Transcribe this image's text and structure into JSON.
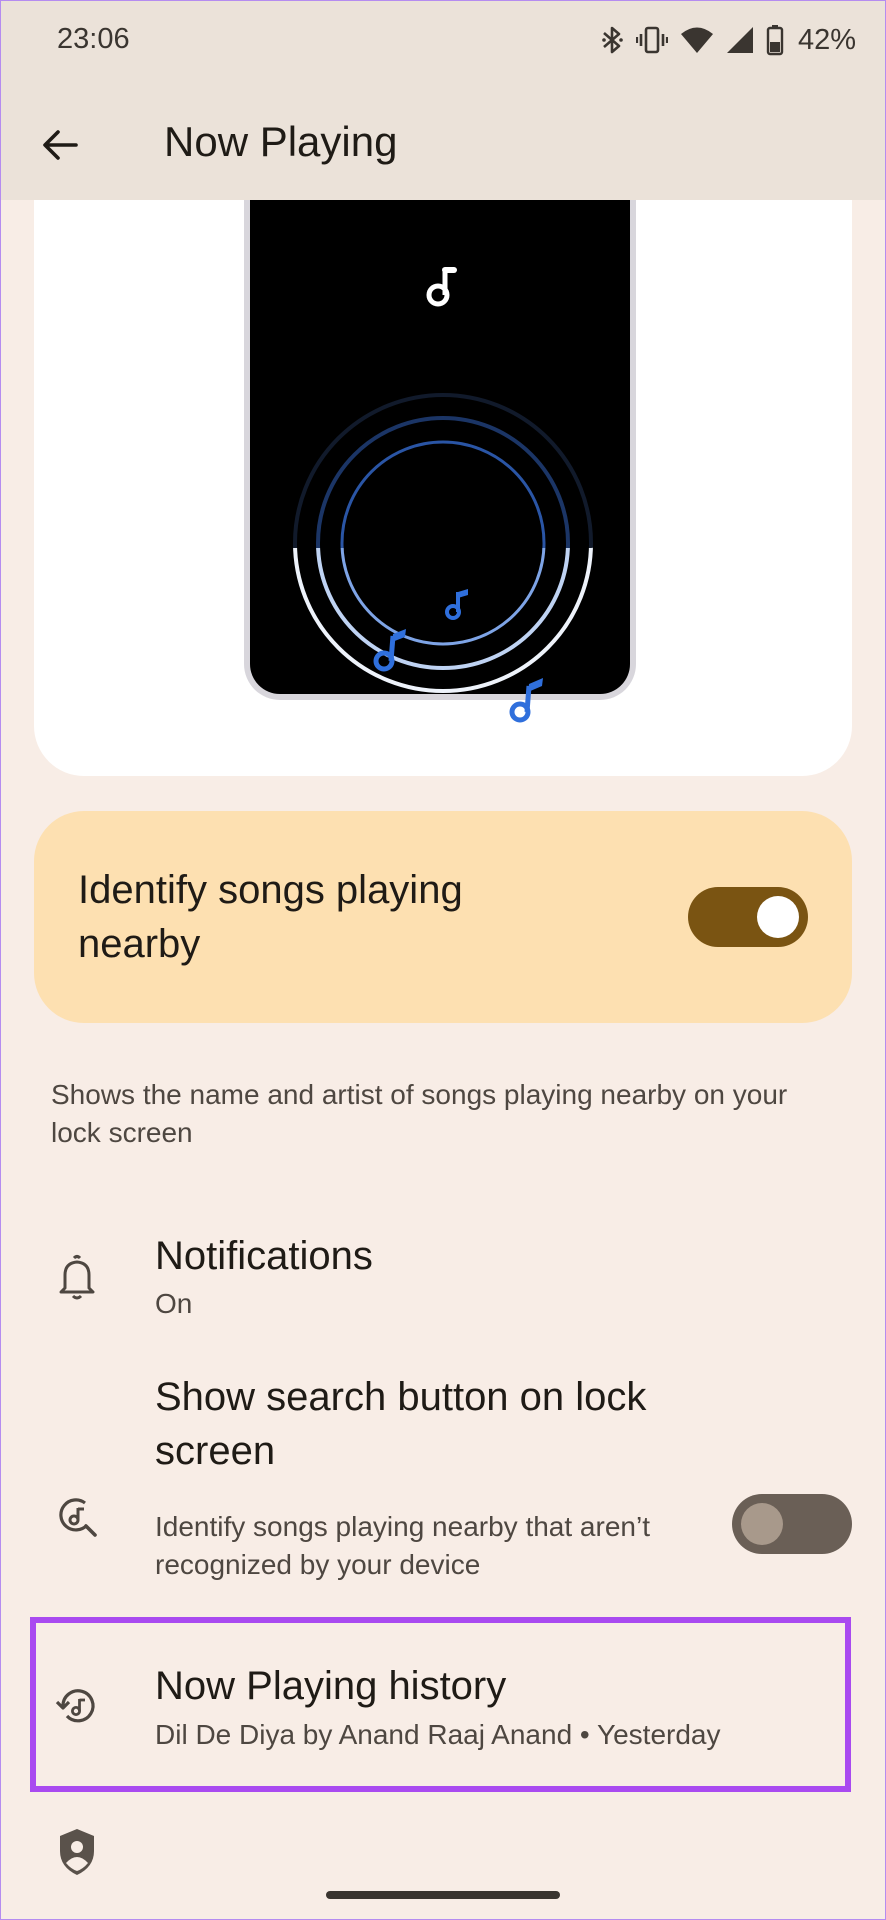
{
  "status_bar": {
    "time": "23:06",
    "battery": "42%",
    "icons": [
      "bluetooth-icon",
      "vibrate-icon",
      "wifi-icon",
      "signal-icon",
      "battery-icon"
    ]
  },
  "app_bar": {
    "title": "Now Playing",
    "back_icon": "arrow-back-icon"
  },
  "main_toggle": {
    "label": "Identify songs playing nearby",
    "enabled": true
  },
  "description": "Shows the name and artist of songs playing nearby on your lock screen",
  "settings": {
    "notifications": {
      "title": "Notifications",
      "subtitle": "On",
      "icon": "bell-icon"
    },
    "search_button": {
      "title": "Show search button on lock screen",
      "subtitle": "Identify songs playing nearby that aren’t recognized by your device",
      "icon": "music-search-icon",
      "enabled": false
    },
    "history": {
      "title": "Now Playing history",
      "subtitle": "Dil De Diya by Anand Raaj Anand • Yesterday",
      "icon": "music-history-icon"
    },
    "privacy": {
      "icon": "shield-person-icon"
    }
  },
  "colors": {
    "background": "#f8ede6",
    "toolbar": "#ebe2d9",
    "toggle_card": "#fde0b1",
    "switch_on": "#7a5412",
    "accent_blue": "#2f6fdc",
    "highlight": "#a94af0"
  }
}
